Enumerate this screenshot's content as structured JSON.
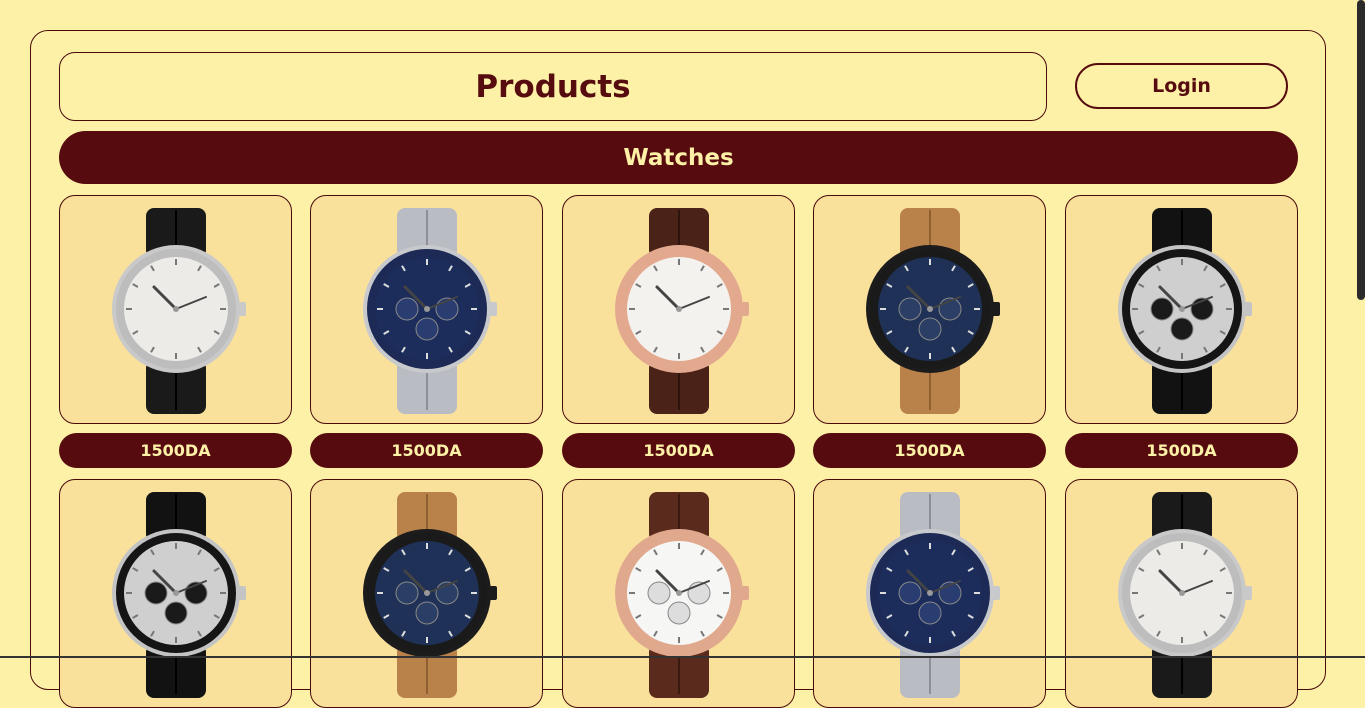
{
  "header": {
    "title": "Products",
    "login_label": "Login"
  },
  "category": {
    "label": "Watches"
  },
  "products": [
    {
      "style": "dress-black-strap",
      "price": "1500DA"
    },
    {
      "style": "blue-chrono-steel",
      "price": "1500DA"
    },
    {
      "style": "rose-brown-strap",
      "price": "1500DA"
    },
    {
      "style": "blue-chrono-tan-leather",
      "price": "1500DA"
    },
    {
      "style": "panda-chrono-rubber",
      "price": "1500DA"
    },
    {
      "style": "panda-chrono-rubber",
      "price": ""
    },
    {
      "style": "blue-chrono-tan-leather",
      "price": ""
    },
    {
      "style": "white-chrono-brown-leather",
      "price": ""
    },
    {
      "style": "blue-chrono-steel",
      "price": ""
    },
    {
      "style": "dress-black-strap",
      "price": ""
    }
  ],
  "colors": {
    "background": "#fdf1a8",
    "accent": "#560b0e",
    "card": "#f9e19c"
  }
}
